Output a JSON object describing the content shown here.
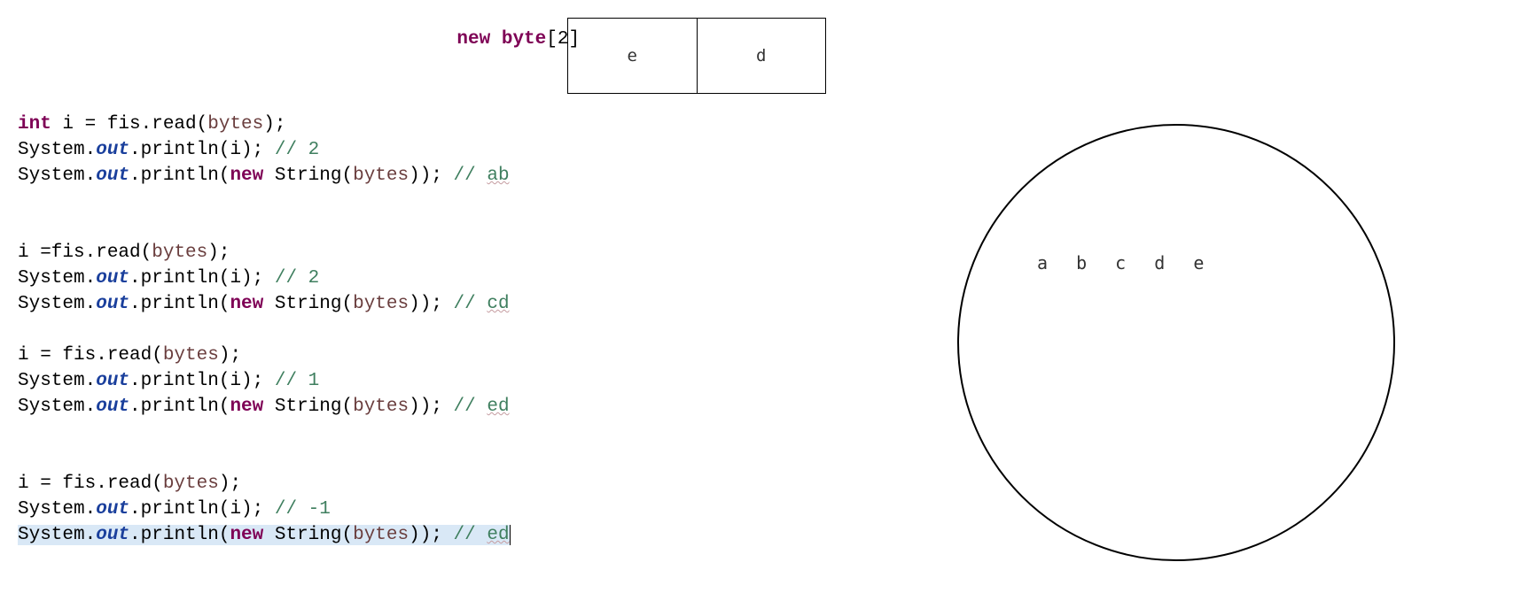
{
  "header": {
    "new_kw": "new ",
    "byte_kw": "byte",
    "suffix": "[2]"
  },
  "table": {
    "cell_left": "e",
    "cell_right": "d"
  },
  "circle": {
    "letters": "a b c d e"
  },
  "code": {
    "l01a": "int",
    "l01b": " i = fis.read(",
    "l01c": "bytes",
    "l01d": ");",
    "l02a": "System.",
    "l02b": "out",
    "l02c": ".println(i); ",
    "l02d": "// 2",
    "l03a": "System.",
    "l03b": "out",
    "l03c": ".println(",
    "l03d": "new",
    "l03e": " String(",
    "l03f": "bytes",
    "l03g": ")); ",
    "l03h": "// ",
    "l03i": "ab",
    "l05a": "i =fis.read(",
    "l05b": "bytes",
    "l05c": ");",
    "l06d": "// 2",
    "l07i": "cd",
    "l09a": "i = fis.read(",
    "l10d": "// 1",
    "l11i": "ed",
    "l13a": "i = fis.read(",
    "l14d": "// -1",
    "l15i": "ed"
  }
}
